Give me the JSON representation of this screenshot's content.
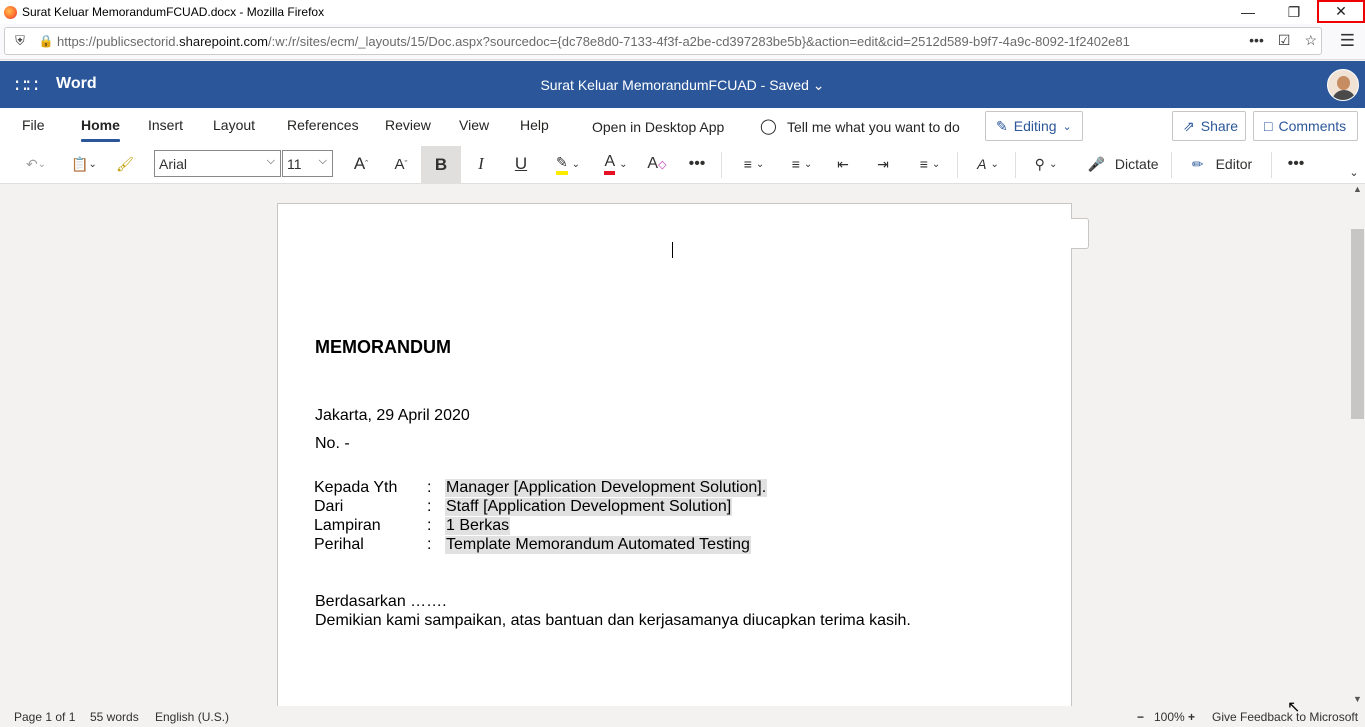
{
  "browser": {
    "window_title": "Surat Keluar MemorandumFCUAD.docx - Mozilla Firefox",
    "url_prefix": "https://publicsectorid.",
    "url_domain": "sharepoint.com",
    "url_rest": "/:w:/r/sites/ecm/_layouts/15/Doc.aspx?sourcedoc={dc78e8d0-7133-4f3f-a2be-cd397283be5b}&action=edit&cid=2512d589-b9f7-4a9c-8092-1f2402e81",
    "icons": {
      "shield": "shield-icon",
      "lock": "lock-icon",
      "more": "ellipsis-icon",
      "pocket": "pocket-icon",
      "star": "bookmark-star-icon",
      "menu": "hamburger-menu-icon"
    }
  },
  "word": {
    "app_name": "Word",
    "doc_title": "Surat Keluar MemorandumFCUAD  -  Saved ⌄",
    "tabs": [
      "File",
      "Home",
      "Insert",
      "Layout",
      "References",
      "Review",
      "View",
      "Help"
    ],
    "active_tab": "Home",
    "open_desktop": "Open in Desktop App",
    "tell_me": "Tell me what you want to do",
    "editing": "Editing",
    "share": "Share",
    "comments": "Comments",
    "font_name": "Arial",
    "font_size": "11",
    "dictate": "Dictate",
    "editor": "Editor",
    "accent_color": "#2b579a"
  },
  "document": {
    "heading": "MEMORANDUM",
    "date": "Jakarta, 29 April 2020",
    "number": "No. -",
    "fields": [
      {
        "label": "Kepada  Yth",
        "colon": ":",
        "value": "Manager [Application Development Solution]."
      },
      {
        "label": "Dari",
        "colon": ":",
        "value": "Staff [Application Development Solution]"
      },
      {
        "label": "Lampiran",
        "colon": ":",
        "value": "1 Berkas"
      },
      {
        "label": "Perihal",
        "colon": ":",
        "value": "Template Memorandum Automated Testing"
      }
    ],
    "body1": "Berdasarkan …….",
    "body2": "Demikian kami sampaikan, atas bantuan dan kerjasamanya diucapkan terima kasih."
  },
  "status": {
    "page": "Page 1 of 1",
    "words": "55 words",
    "language": "English (U.S.)",
    "zoom": "100%",
    "feedback": "Give Feedback to Microsoft"
  }
}
